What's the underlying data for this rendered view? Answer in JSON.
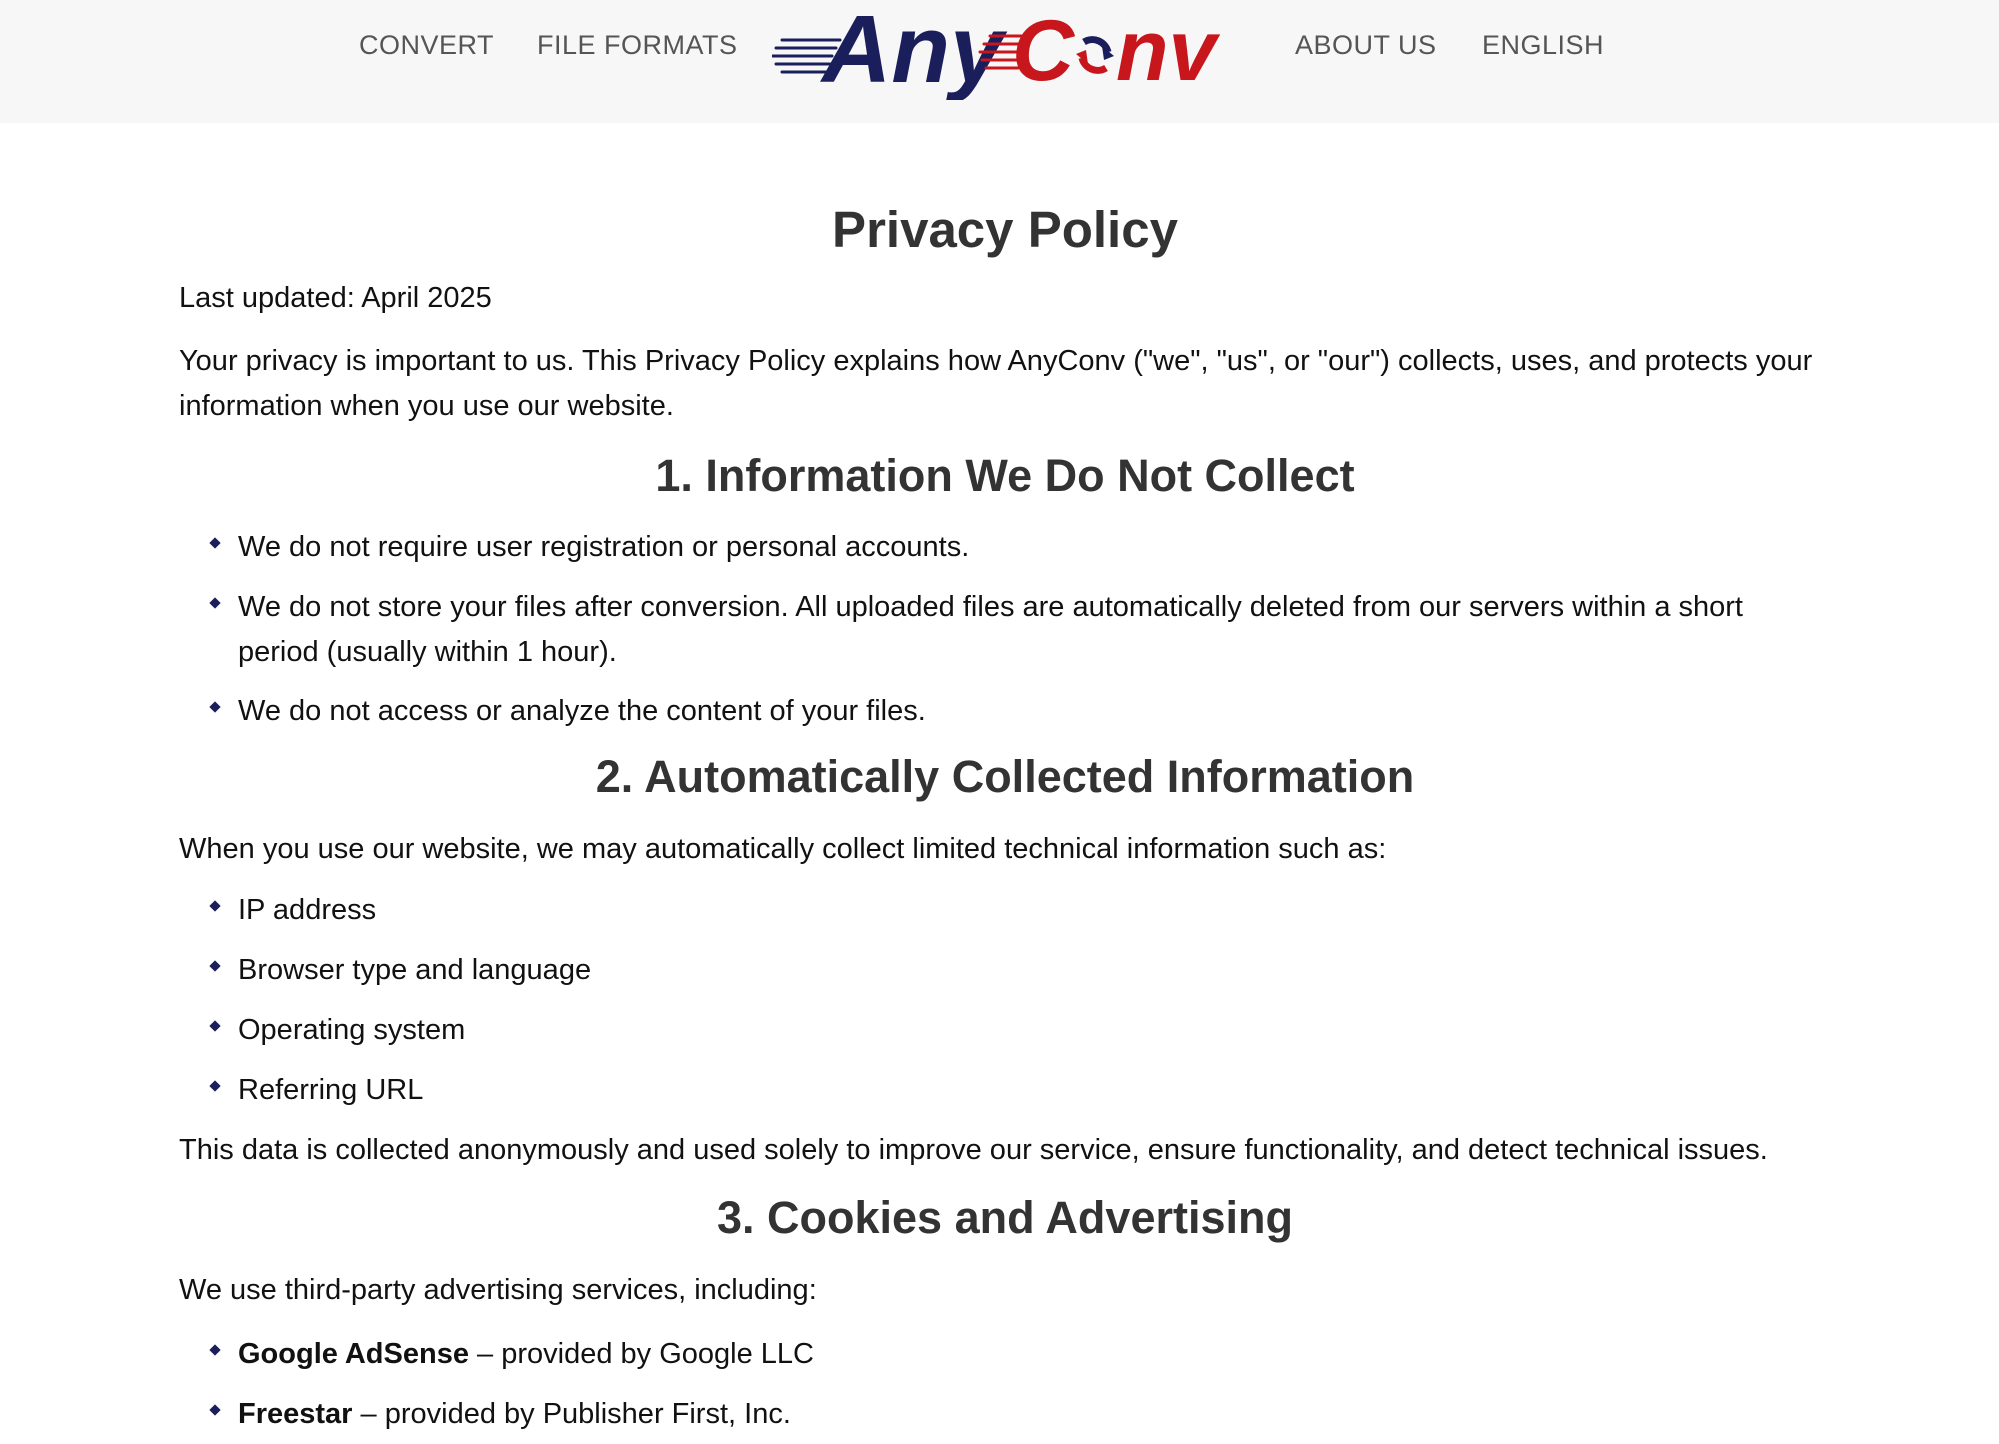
{
  "nav": {
    "convert": "CONVERT",
    "file_formats": "FILE FORMATS",
    "about_us": "ABOUT US",
    "language": "ENGLISH"
  },
  "logo": {
    "part1": "Any",
    "part2_c": "C",
    "part2_nv": "nv",
    "colors": {
      "navy": "#1a1f5c",
      "red": "#c8161d"
    }
  },
  "page": {
    "title": "Privacy Policy",
    "last_updated": "Last updated: April 2025",
    "intro": "Your privacy is important to us. This Privacy Policy explains how AnyConv (\"we\", \"us\", or \"our\") collects, uses, and protects your information when you use our website."
  },
  "section1": {
    "title": "1. Information We Do Not Collect",
    "items": [
      "We do not require user registration or personal accounts.",
      "We do not store your files after conversion. All uploaded files are automatically deleted from our servers within a short period (usually within 1 hour).",
      "We do not access or analyze the content of your files."
    ]
  },
  "section2": {
    "title": "2. Automatically Collected Information",
    "intro": "When you use our website, we may automatically collect limited technical information such as:",
    "items": [
      "IP address",
      "Browser type and language",
      "Operating system",
      "Referring URL"
    ],
    "outro": "This data is collected anonymously and used solely to improve our service, ensure functionality, and detect technical issues."
  },
  "section3": {
    "title": "3. Cookies and Advertising",
    "intro": "We use third-party advertising services, including:",
    "items": [
      {
        "name": "Google AdSense",
        "desc": " – provided by Google LLC"
      },
      {
        "name": "Freestar",
        "desc": " – provided by Publisher First, Inc."
      }
    ]
  }
}
